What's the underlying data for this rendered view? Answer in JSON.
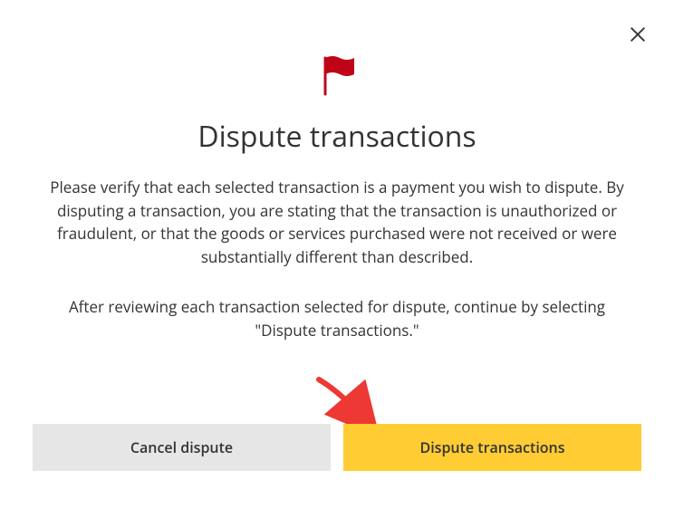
{
  "modal": {
    "title": "Dispute transactions",
    "description": "Please verify that each selected transaction is a payment you wish to dispute. By disputing a transaction, you are stating that the transaction is unauthorized or fraudulent, or that the goods or services purchased were not received or were substantially different than described.",
    "instruction": "After reviewing each transaction selected for dispute, continue by selecting \"Dispute transactions.\"",
    "buttons": {
      "cancel": "Cancel dispute",
      "confirm": "Dispute transactions"
    }
  },
  "colors": {
    "flag": "#c00418",
    "primary_button": "#ffcc33",
    "cancel_button": "#e6e6e6",
    "arrow": "#ed3833"
  }
}
